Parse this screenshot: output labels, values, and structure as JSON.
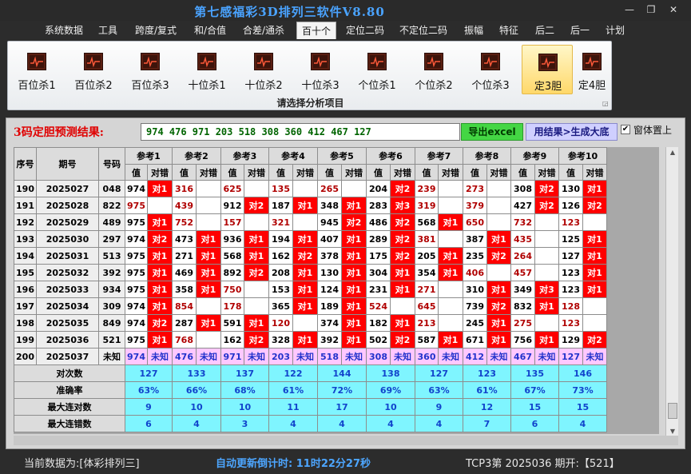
{
  "window": {
    "title": "第七感福彩3D排列三软件V8.80",
    "controls": [
      "—",
      "❐",
      "✕"
    ]
  },
  "menu": {
    "items": [
      "系统数据",
      "工具",
      "跨度/复式",
      "和/合值",
      "合差/通杀",
      "百十个",
      "定位二码",
      "不定位二码",
      "振幅",
      "特征",
      "后二",
      "后一",
      "计划"
    ],
    "active": "百十个"
  },
  "ribbon": {
    "buttons": [
      "百位杀1",
      "百位杀2",
      "百位杀3",
      "十位杀1",
      "十位杀2",
      "十位杀3",
      "个位杀1",
      "个位杀2",
      "个位杀3",
      "定3胆",
      "定4胆"
    ],
    "active_index": 9,
    "caption": "请选择分析项目",
    "icon": "chart-icon"
  },
  "prediction": {
    "label": "3码定胆预测结果:",
    "value": "974  476  971  203  518  308  360  412  467  127",
    "export_label": "导出excel",
    "generate_label": "用结果>生成大底",
    "topmost_label": "窗体置上",
    "topmost_checked": true
  },
  "table": {
    "headers": {
      "seq": "序号",
      "issue": "期号",
      "number": "号码",
      "refs": [
        "参考1",
        "参考2",
        "参考3",
        "参考4",
        "参考5",
        "参考6",
        "参考7",
        "参考8",
        "参考9",
        "参考10"
      ],
      "sub_value": "值",
      "sub_result": "对错"
    },
    "rows": [
      {
        "seq": "190",
        "issue": "2025027",
        "num": "048",
        "cells": [
          [
            "974",
            "对1"
          ],
          [
            "316",
            ""
          ],
          [
            "625",
            ""
          ],
          [
            "135",
            ""
          ],
          [
            "265",
            ""
          ],
          [
            "204",
            "对2"
          ],
          [
            "239",
            ""
          ],
          [
            "273",
            ""
          ],
          [
            "308",
            "对2"
          ],
          [
            "130",
            "对1"
          ]
        ]
      },
      {
        "seq": "191",
        "issue": "2025028",
        "num": "822",
        "cells": [
          [
            "975",
            ""
          ],
          [
            "439",
            ""
          ],
          [
            "912",
            "对2"
          ],
          [
            "187",
            "对1"
          ],
          [
            "348",
            "对1"
          ],
          [
            "283",
            "对3"
          ],
          [
            "319",
            ""
          ],
          [
            "379",
            ""
          ],
          [
            "427",
            "对2"
          ],
          [
            "126",
            "对2"
          ]
        ]
      },
      {
        "seq": "192",
        "issue": "2025029",
        "num": "489",
        "cells": [
          [
            "975",
            "对1"
          ],
          [
            "752",
            ""
          ],
          [
            "157",
            ""
          ],
          [
            "321",
            ""
          ],
          [
            "945",
            "对2"
          ],
          [
            "486",
            "对2"
          ],
          [
            "568",
            "对1"
          ],
          [
            "650",
            ""
          ],
          [
            "732",
            ""
          ],
          [
            "123",
            ""
          ]
        ]
      },
      {
        "seq": "193",
        "issue": "2025030",
        "num": "297",
        "cells": [
          [
            "974",
            "对2"
          ],
          [
            "473",
            "对1"
          ],
          [
            "936",
            "对1"
          ],
          [
            "194",
            "对1"
          ],
          [
            "407",
            "对1"
          ],
          [
            "289",
            "对2"
          ],
          [
            "381",
            ""
          ],
          [
            "387",
            "对1"
          ],
          [
            "435",
            ""
          ],
          [
            "125",
            "对1"
          ]
        ]
      },
      {
        "seq": "194",
        "issue": "2025031",
        "num": "513",
        "cells": [
          [
            "975",
            "对1"
          ],
          [
            "271",
            "对1"
          ],
          [
            "568",
            "对1"
          ],
          [
            "162",
            "对2"
          ],
          [
            "378",
            "对1"
          ],
          [
            "175",
            "对2"
          ],
          [
            "205",
            "对1"
          ],
          [
            "235",
            "对2"
          ],
          [
            "264",
            ""
          ],
          [
            "127",
            "对1"
          ]
        ]
      },
      {
        "seq": "195",
        "issue": "2025032",
        "num": "392",
        "cells": [
          [
            "975",
            "对1"
          ],
          [
            "469",
            "对1"
          ],
          [
            "892",
            "对2"
          ],
          [
            "208",
            "对1"
          ],
          [
            "130",
            "对1"
          ],
          [
            "304",
            "对1"
          ],
          [
            "354",
            "对1"
          ],
          [
            "406",
            ""
          ],
          [
            "457",
            ""
          ],
          [
            "123",
            "对1"
          ]
        ]
      },
      {
        "seq": "196",
        "issue": "2025033",
        "num": "934",
        "cells": [
          [
            "975",
            "对1"
          ],
          [
            "358",
            "对1"
          ],
          [
            "750",
            ""
          ],
          [
            "153",
            "对1"
          ],
          [
            "124",
            "对1"
          ],
          [
            "231",
            "对1"
          ],
          [
            "271",
            ""
          ],
          [
            "310",
            "对1"
          ],
          [
            "349",
            "对3"
          ],
          [
            "123",
            "对1"
          ]
        ]
      },
      {
        "seq": "197",
        "issue": "2025034",
        "num": "309",
        "cells": [
          [
            "974",
            "对1"
          ],
          [
            "854",
            ""
          ],
          [
            "178",
            ""
          ],
          [
            "365",
            "对1"
          ],
          [
            "189",
            "对1"
          ],
          [
            "524",
            ""
          ],
          [
            "645",
            ""
          ],
          [
            "739",
            "对2"
          ],
          [
            "832",
            "对1"
          ],
          [
            "128",
            ""
          ]
        ]
      },
      {
        "seq": "198",
        "issue": "2025035",
        "num": "849",
        "cells": [
          [
            "974",
            "对2"
          ],
          [
            "287",
            "对1"
          ],
          [
            "591",
            "对1"
          ],
          [
            "120",
            ""
          ],
          [
            "374",
            "对1"
          ],
          [
            "182",
            "对1"
          ],
          [
            "213",
            ""
          ],
          [
            "245",
            "对1"
          ],
          [
            "275",
            ""
          ],
          [
            "123",
            ""
          ]
        ]
      },
      {
        "seq": "199",
        "issue": "2025036",
        "num": "521",
        "cells": [
          [
            "975",
            "对1"
          ],
          [
            "768",
            ""
          ],
          [
            "162",
            "对2"
          ],
          [
            "328",
            "对1"
          ],
          [
            "392",
            "对1"
          ],
          [
            "502",
            "对2"
          ],
          [
            "587",
            "对1"
          ],
          [
            "671",
            "对1"
          ],
          [
            "756",
            "对1"
          ],
          [
            "129",
            "对2"
          ]
        ]
      }
    ],
    "unknown_row": {
      "seq": "200",
      "issue": "2025037",
      "num": "未知",
      "values": [
        "974",
        "476",
        "971",
        "203",
        "518",
        "308",
        "360",
        "412",
        "467",
        "127"
      ],
      "result": "未知"
    },
    "stats": [
      {
        "label": "对次数",
        "values": [
          "127",
          "133",
          "137",
          "122",
          "144",
          "138",
          "127",
          "123",
          "135",
          "146"
        ]
      },
      {
        "label": "准确率",
        "values": [
          "63%",
          "66%",
          "68%",
          "61%",
          "72%",
          "69%",
          "63%",
          "61%",
          "67%",
          "73%"
        ]
      },
      {
        "label": "最大连对数",
        "values": [
          "9",
          "10",
          "10",
          "11",
          "17",
          "10",
          "9",
          "12",
          "15",
          "15"
        ]
      },
      {
        "label": "最大连错数",
        "values": [
          "6",
          "4",
          "3",
          "4",
          "4",
          "4",
          "4",
          "7",
          "6",
          "4"
        ]
      }
    ]
  },
  "status": {
    "current_data": "当前数据为:[体彩排列三]",
    "countdown": "自动更新倒计时:  11时22分27秒",
    "issue_info": "TCP3第 2025036 期开:【521】"
  },
  "colors": {
    "title": "#4aa3ff",
    "hit": "#ff0000",
    "unknown": "#ffc8ff",
    "stats": "#7ff5ff",
    "countdown": "#4da6ff"
  }
}
